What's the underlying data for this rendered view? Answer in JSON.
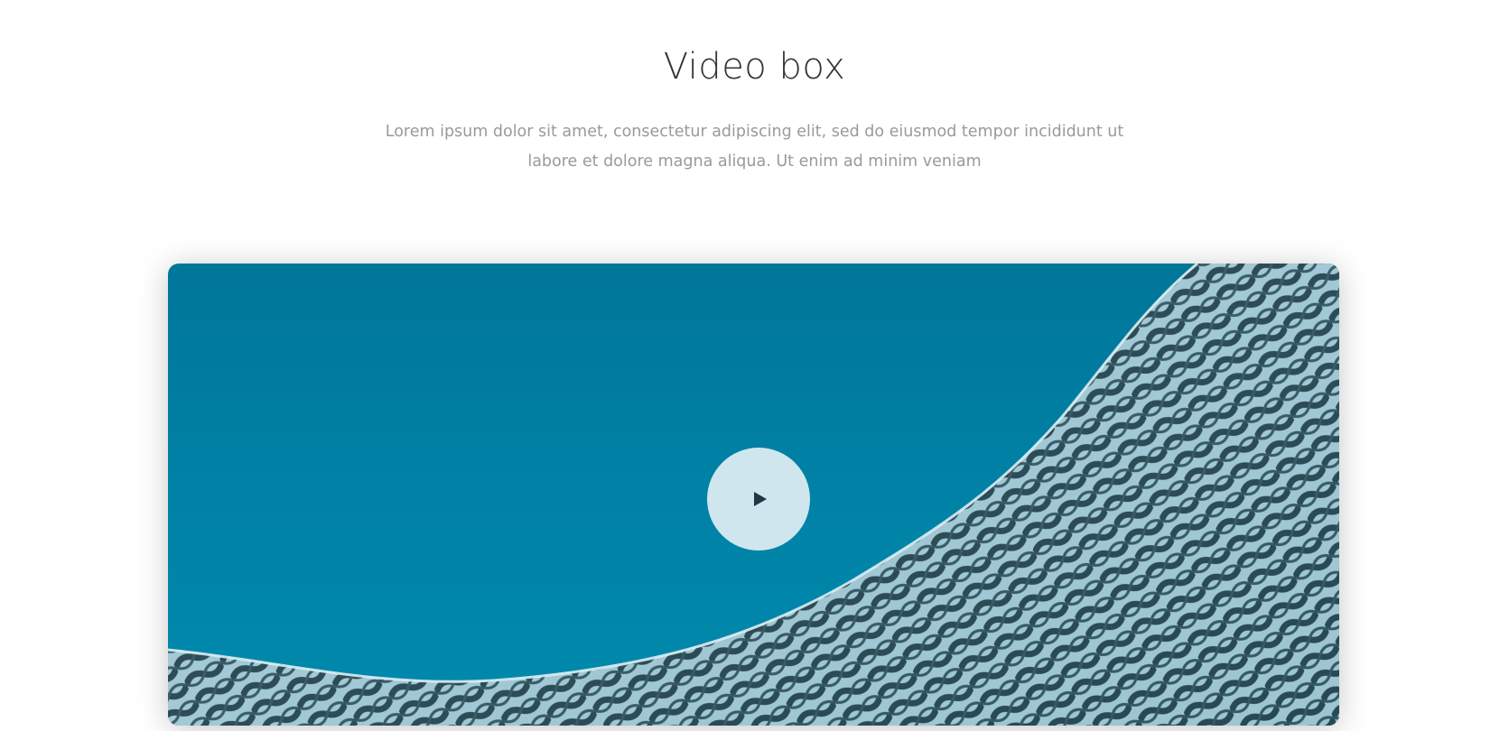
{
  "section": {
    "title": "Video box",
    "description_line1": "Lorem ipsum dolor sit amet, consectetur adipiscing elit, sed do eiusmod tempor incididunt ut",
    "description_line2": "labore et dolore magna aliqua. Ut enim ad minim veniam"
  },
  "video": {
    "thumbnail": "blue sky with curved metal facade building",
    "play_icon": "play-icon"
  },
  "colors": {
    "sky_top": "#00769a",
    "sky_bottom": "#008aad",
    "play_circle": "#cfe6ee",
    "play_glyph": "#1f3a44",
    "title": "#333333",
    "text": "#9a9a9a"
  }
}
